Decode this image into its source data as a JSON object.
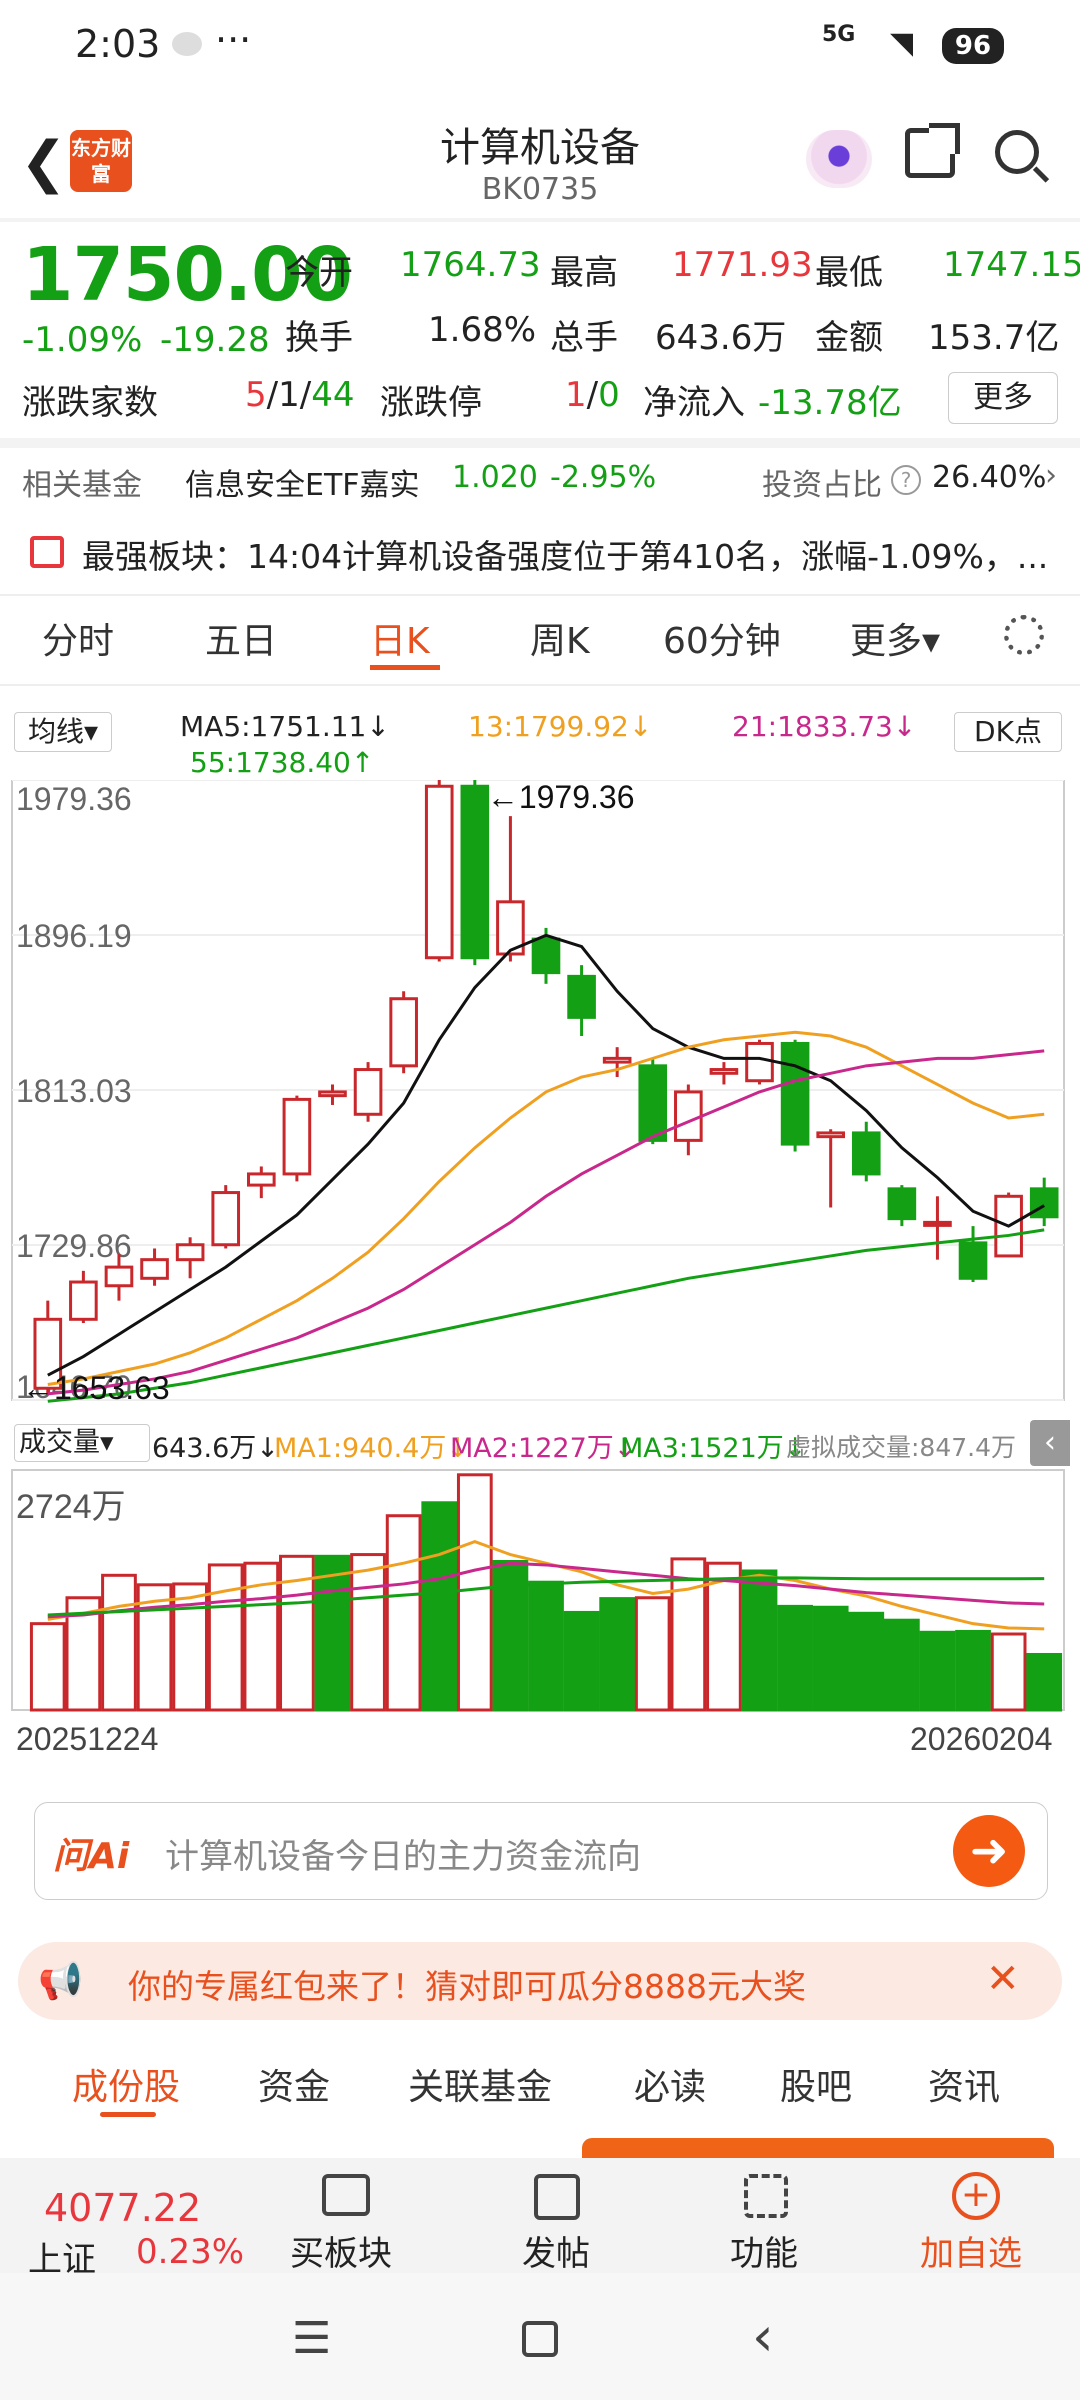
{
  "status": {
    "time": "2:03",
    "dots": "···",
    "net": "5G",
    "battery": "96"
  },
  "header": {
    "title": "计算机设备",
    "code": "BK0735",
    "logo_text": "东方财富"
  },
  "quote": {
    "price": "1750.00",
    "pct": "-1.09%",
    "chg": "-19.28",
    "open_label": "今开",
    "open": "1764.73",
    "high_label": "最高",
    "high": "1771.93",
    "low_label": "最低",
    "low": "1747.15",
    "turn_label": "换手",
    "turn": "1.68%",
    "vol_label": "总手",
    "vol": "643.6万",
    "amt_label": "金额",
    "amt": "153.7亿",
    "updown_label": "涨跌家数",
    "up": "5",
    "flat": "1",
    "down": "44",
    "limit_label": "涨跌停",
    "limit_up": "1",
    "limit_down": "0",
    "inflow_label": "净流入",
    "inflow": "-13.78亿",
    "more": "更多"
  },
  "fund": {
    "label": "相关基金",
    "name": "信息安全ETF嘉实",
    "nav": "1.020",
    "pct": "-2.95%",
    "ratio_label": "投资占比",
    "ratio": "26.40%"
  },
  "news": {
    "text": "最强板块：14:04计算机设备强度位于第410名，涨幅-1.09%，..."
  },
  "ktabs": [
    "分时",
    "五日",
    "日K",
    "周K",
    "60分钟",
    "更多▾"
  ],
  "ma": {
    "selector": "均线▾",
    "ma5": "MA5:1751.11↓",
    "ma13": "13:1799.92↓",
    "ma21": "21:1833.73↓",
    "ma55": "55:1738.40↑",
    "dk": "DK点"
  },
  "vol_legend": {
    "selector": "成交量▾",
    "vol": "643.6万↓",
    "ma1": "MA1:940.4万↓",
    "ma2": "MA2:1227万↓",
    "ma3": "MA3:1521万↓",
    "virtual": "虚拟成交量:847.4万",
    "max": "2724万"
  },
  "chart_data": {
    "type": "candlestick",
    "y_ticks": [
      "1979.36",
      "1896.19",
      "1813.03",
      "1729.86",
      "1646.70"
    ],
    "ylim": [
      1646.7,
      1979.36
    ],
    "max_label": "←1979.36",
    "min_label": "←1653.63",
    "start_date": "20251224",
    "end_date": "20260204",
    "candles": [
      [
        1653,
        1690,
        1650,
        1700
      ],
      [
        1690,
        1710,
        1688,
        1716
      ],
      [
        1708,
        1718,
        1700,
        1725
      ],
      [
        1712,
        1722,
        1708,
        1728
      ],
      [
        1722,
        1730,
        1712,
        1734
      ],
      [
        1730,
        1758,
        1728,
        1762
      ],
      [
        1762,
        1768,
        1755,
        1772
      ],
      [
        1768,
        1808,
        1764,
        1810
      ],
      [
        1810,
        1812,
        1805,
        1816
      ],
      [
        1800,
        1824,
        1796,
        1828
      ],
      [
        1826,
        1862,
        1822,
        1866
      ],
      [
        1884,
        1976,
        1882,
        1980
      ],
      [
        1976,
        1884,
        1880,
        1980
      ],
      [
        1886,
        1914,
        1882,
        1960
      ],
      [
        1894,
        1876,
        1870,
        1900
      ],
      [
        1874,
        1852,
        1842,
        1880
      ],
      [
        1828,
        1830,
        1820,
        1836
      ],
      [
        1826,
        1786,
        1784,
        1830
      ],
      [
        1786,
        1812,
        1778,
        1816
      ],
      [
        1822,
        1824,
        1816,
        1828
      ],
      [
        1818,
        1838,
        1816,
        1840
      ],
      [
        1838,
        1784,
        1780,
        1840
      ],
      [
        1788,
        1790,
        1750,
        1792
      ],
      [
        1790,
        1768,
        1764,
        1796
      ],
      [
        1760,
        1744,
        1740,
        1762
      ],
      [
        1741,
        1742,
        1722,
        1756
      ],
      [
        1731,
        1712,
        1710,
        1740
      ],
      [
        1724,
        1756,
        1724,
        1758
      ],
      [
        1760,
        1745,
        1740,
        1766
      ]
    ],
    "ma5": [
      1660,
      1670,
      1682,
      1694,
      1706,
      1718,
      1732,
      1746,
      1765,
      1784,
      1806,
      1840,
      1868,
      1888,
      1896,
      1890,
      1866,
      1846,
      1836,
      1830,
      1830,
      1826,
      1818,
      1802,
      1782,
      1766,
      1748,
      1740,
      1751
    ],
    "ma13": [
      1655,
      1658,
      1662,
      1666,
      1672,
      1680,
      1690,
      1700,
      1712,
      1726,
      1744,
      1764,
      1782,
      1798,
      1812,
      1820,
      1824,
      1830,
      1836,
      1840,
      1842,
      1844,
      1842,
      1836,
      1826,
      1816,
      1806,
      1798,
      1800
    ],
    "ma21": [
      1650,
      1652,
      1655,
      1658,
      1662,
      1668,
      1674,
      1680,
      1688,
      1696,
      1706,
      1718,
      1730,
      1742,
      1756,
      1768,
      1778,
      1788,
      1796,
      1804,
      1812,
      1818,
      1822,
      1826,
      1828,
      1830,
      1830,
      1832,
      1834
    ],
    "ma55": [
      1646,
      1648,
      1650,
      1653,
      1656,
      1660,
      1664,
      1668,
      1672,
      1676,
      1680,
      1684,
      1688,
      1692,
      1696,
      1700,
      1704,
      1708,
      1712,
      1715,
      1718,
      1721,
      1724,
      1727,
      1729,
      1731,
      1733,
      1735,
      1738
    ],
    "volumes": [
      1000,
      1300,
      1560,
      1450,
      1460,
      1680,
      1700,
      1780,
      1780,
      1800,
      2250,
      2400,
      2724,
      1720,
      1480,
      1130,
      1290,
      1300,
      1750,
      1700,
      1610,
      1200,
      1190,
      1120,
      1040,
      900,
      910,
      880,
      643
    ],
    "vol_up": [
      true,
      true,
      true,
      true,
      true,
      true,
      true,
      true,
      false,
      true,
      true,
      false,
      true,
      false,
      false,
      false,
      false,
      true,
      true,
      true,
      false,
      false,
      false,
      false,
      false,
      false,
      false,
      true,
      false
    ],
    "vma1": [
      1050,
      1120,
      1200,
      1260,
      1300,
      1380,
      1450,
      1500,
      1560,
      1620,
      1700,
      1800,
      1950,
      1800,
      1700,
      1600,
      1450,
      1350,
      1400,
      1500,
      1560,
      1500,
      1400,
      1320,
      1200,
      1100,
      1000,
      950,
      940
    ],
    "vma2": [
      1080,
      1100,
      1150,
      1190,
      1220,
      1260,
      1290,
      1330,
      1380,
      1420,
      1460,
      1520,
      1620,
      1700,
      1680,
      1640,
      1600,
      1560,
      1520,
      1500,
      1470,
      1440,
      1400,
      1360,
      1330,
      1300,
      1270,
      1240,
      1227
    ],
    "vma3": [
      1100,
      1120,
      1140,
      1160,
      1180,
      1200,
      1220,
      1240,
      1270,
      1300,
      1330,
      1360,
      1400,
      1440,
      1460,
      1480,
      1490,
      1500,
      1510,
      1520,
      1530,
      1530,
      1525,
      1520,
      1520,
      1520,
      1520,
      1520,
      1521
    ]
  },
  "ai": {
    "logo": "问Ai",
    "placeholder": "计算机设备今日的主力资金流向"
  },
  "promo": {
    "text": "你的专属红包来了！猜对即可瓜分8888元大奖"
  },
  "btabs": [
    "成份股",
    "资金",
    "关联基金",
    "必读",
    "股吧",
    "资讯"
  ],
  "bottom": {
    "index_value": "4077.22",
    "index_name": "上证",
    "index_pct": "0.23%",
    "buy": "买板块",
    "post": "发帖",
    "func": "功能",
    "add": "加自选"
  }
}
